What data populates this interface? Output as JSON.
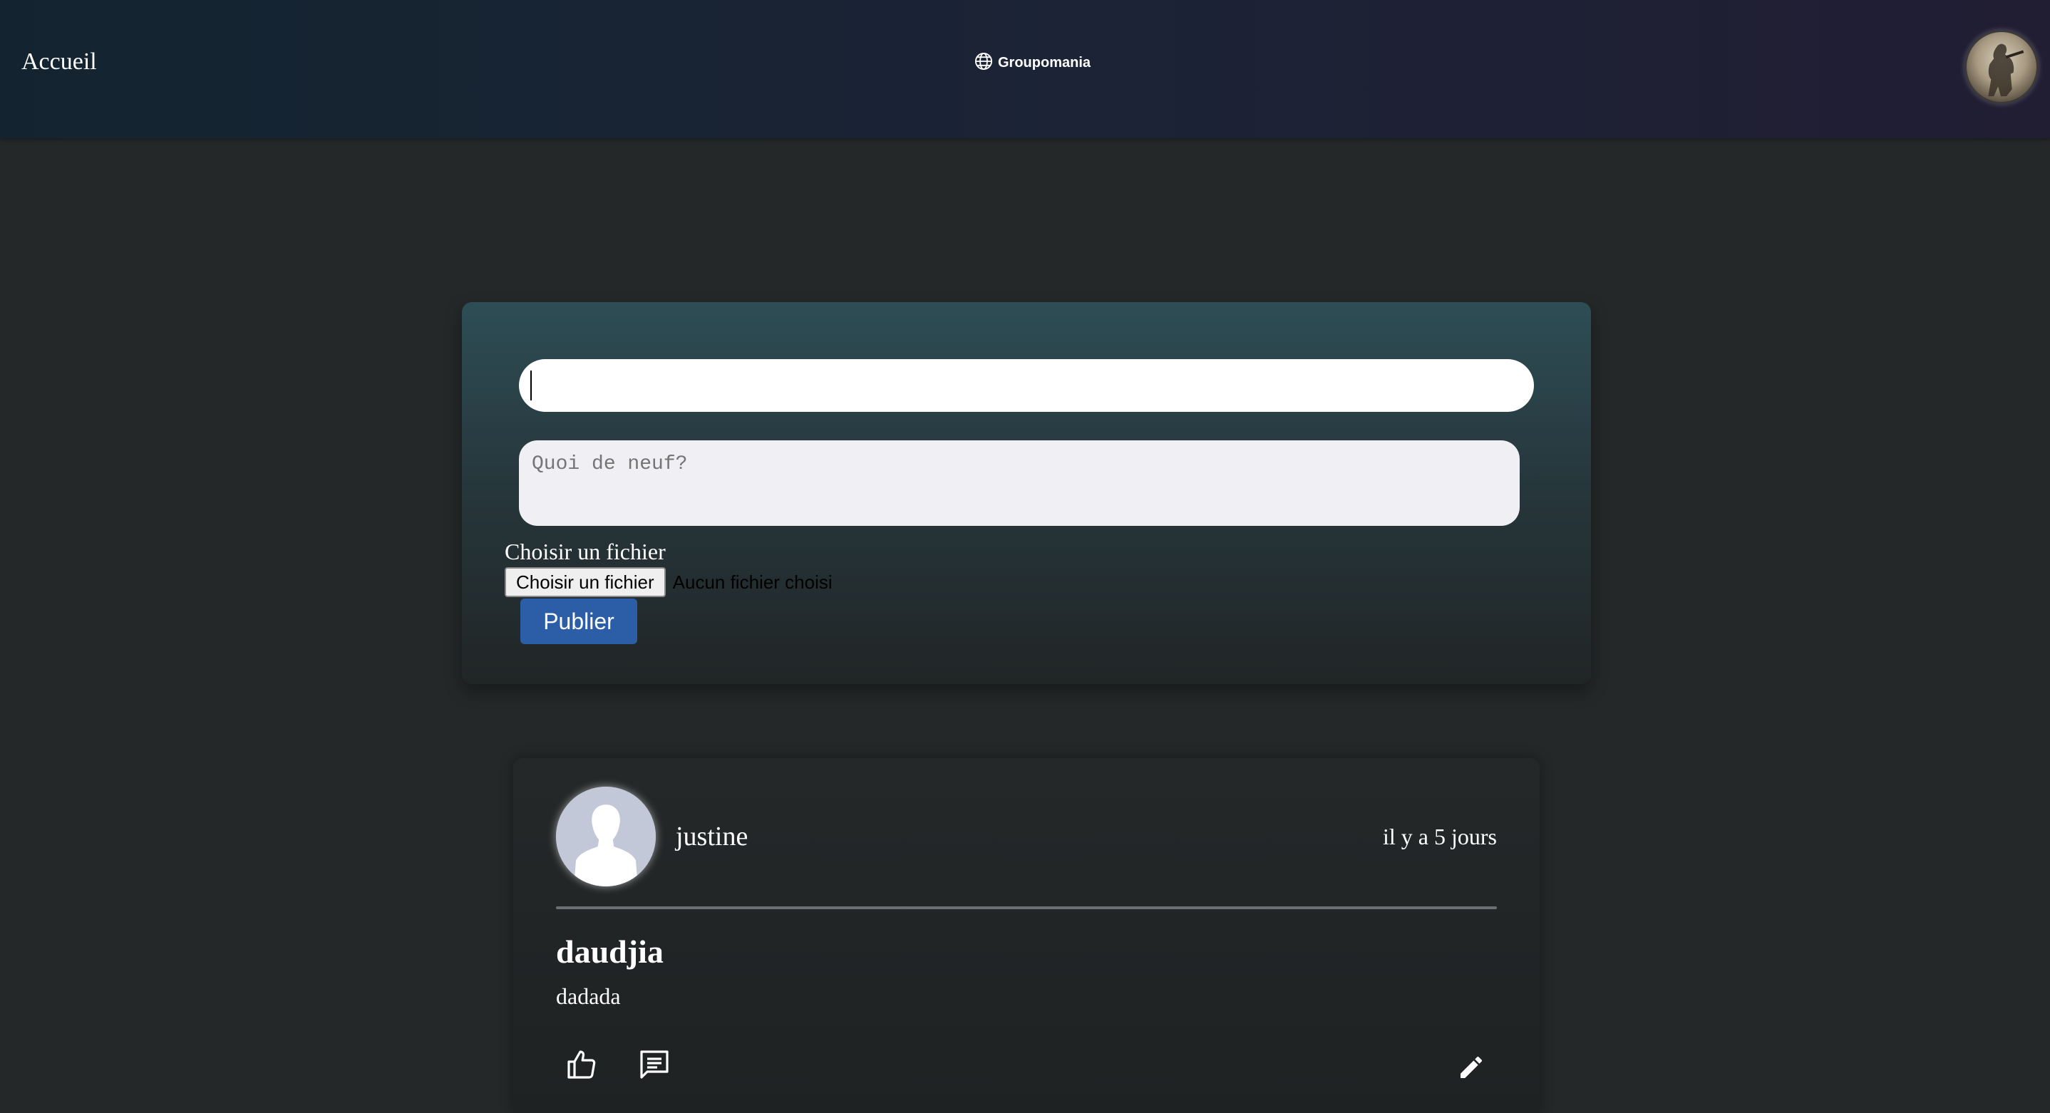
{
  "header": {
    "home_link": "Accueil",
    "brand_name": "Groupomania",
    "brand_icon": "globe-icon",
    "profile_avatar": "user-avatar"
  },
  "compose": {
    "title_value": "",
    "content_placeholder": "Quoi de neuf?",
    "file_label": "Choisir un fichier",
    "file_button_label": "Choisir un fichier",
    "file_status": "Aucun fichier choisi",
    "publish_label": "Publier"
  },
  "posts": [
    {
      "author": "justine",
      "time": "il y a 5 jours",
      "title": "daudjia",
      "body": "dadada",
      "avatar": "default-user-avatar",
      "actions": {
        "like_icon": "thumb-up-icon",
        "comment_icon": "comment-icon",
        "edit_icon": "pencil-icon"
      }
    }
  ],
  "colors": {
    "page_background": "#242829",
    "publish_button": "#2b5ea6",
    "topbar_start": "#132430",
    "topbar_end": "#211d33"
  }
}
